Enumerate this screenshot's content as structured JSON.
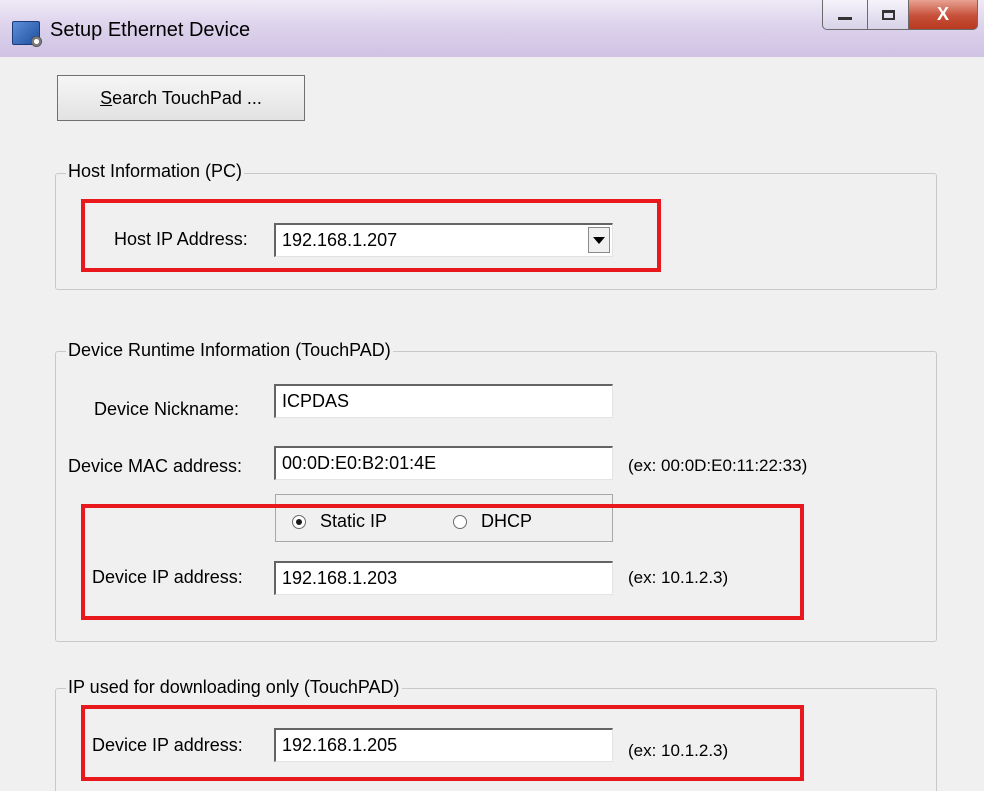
{
  "window": {
    "title": "Setup Ethernet Device",
    "close_glyph": "X"
  },
  "search_button": {
    "accel": "S",
    "rest": "earch TouchPad ..."
  },
  "host_group": {
    "legend": "Host Information (PC)",
    "ip_label": "Host IP Address:",
    "ip_value": "192.168.1.207"
  },
  "runtime_group": {
    "legend": "Device Runtime Information (TouchPAD)",
    "nickname_label": "Device Nickname:",
    "nickname_value": "ICPDAS",
    "mac_label": "Device MAC address:",
    "mac_value": "00:0D:E0:B2:01:4E",
    "mac_hint": "(ex: 00:0D:E0:11:22:33)",
    "radio_static": "Static IP",
    "radio_dhcp": "DHCP",
    "selected_mode": "Static IP",
    "ip_label": "Device IP address:",
    "ip_value": "192.168.1.203",
    "ip_hint": "(ex: 10.1.2.3)"
  },
  "download_group": {
    "legend": "IP used for downloading only (TouchPAD)",
    "ip_label": "Device IP address:",
    "ip_value": "192.168.1.205",
    "ip_hint": "(ex: 10.1.2.3)"
  },
  "colors": {
    "highlight": "#e8181c",
    "titlebar": "#ddd3ec"
  }
}
